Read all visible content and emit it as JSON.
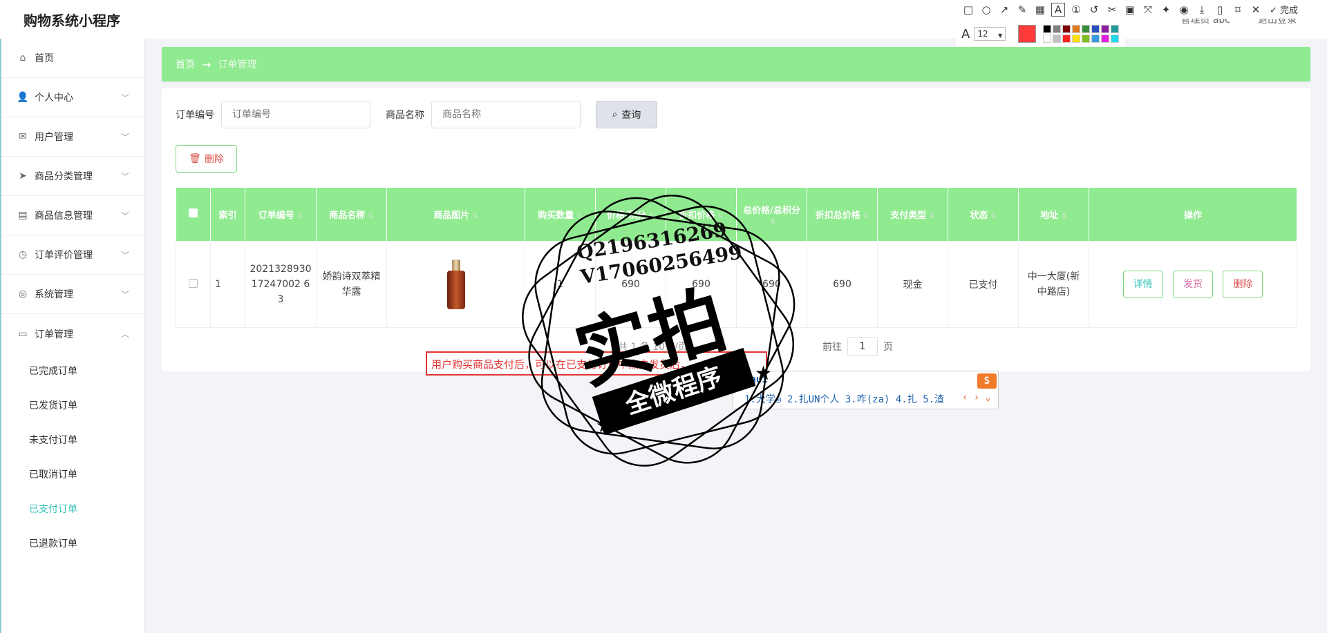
{
  "app": {
    "title": "购物系统小程序",
    "user_label": "管理员 abc",
    "logout_label": "退出登录"
  },
  "sidebar": {
    "items": [
      {
        "label": "首页",
        "icon": "home-icon",
        "expandable": false
      },
      {
        "label": "个人中心",
        "icon": "user-icon",
        "expandable": true
      },
      {
        "label": "用户管理",
        "icon": "mail-icon",
        "expandable": true
      },
      {
        "label": "商品分类管理",
        "icon": "send-icon",
        "expandable": true
      },
      {
        "label": "商品信息管理",
        "icon": "chat-icon",
        "expandable": true
      },
      {
        "label": "订单评价管理",
        "icon": "clock-icon",
        "expandable": true
      },
      {
        "label": "系统管理",
        "icon": "compass-icon",
        "expandable": true
      },
      {
        "label": "订单管理",
        "icon": "message-icon",
        "expandable": true,
        "expanded": true
      }
    ],
    "subitems": [
      {
        "label": "已完成订单"
      },
      {
        "label": "已发货订单"
      },
      {
        "label": "未支付订单"
      },
      {
        "label": "已取消订单"
      },
      {
        "label": "已支付订单",
        "active": true
      },
      {
        "label": "已退款订单"
      }
    ]
  },
  "breadcrumb": {
    "home": "首页",
    "arrow": "→",
    "current": "订单管理"
  },
  "search": {
    "order_no_label": "订单编号",
    "order_no_placeholder": "订单编号",
    "product_name_label": "商品名称",
    "product_name_placeholder": "商品名称",
    "query_label": "查询"
  },
  "toolbar": {
    "delete_label": "删除"
  },
  "table": {
    "headers": [
      "索引",
      "订单编号",
      "商品名称",
      "商品图片",
      "购买数量",
      "价格/积分",
      "折扣价格",
      "总价格/总积分",
      "折扣总价格",
      "支付类型",
      "状态",
      "地址",
      "操作"
    ],
    "rows": [
      {
        "index": "1",
        "order_no": "202132893017247002 63",
        "product_name": "娇韵诗双萃精华露",
        "quantity": "1",
        "price": "690",
        "discount_price": "690",
        "total_price": "690",
        "discount_total": "690",
        "pay_type": "现金",
        "status": "已支付",
        "address": "中一大厦(新中路店)",
        "ops": [
          "详情",
          "发货",
          "删除"
        ]
      }
    ]
  },
  "pager": {
    "partial_text": "共 1 条  10条/页",
    "goto_label": "前往",
    "page_value": "1",
    "page_suffix": "页"
  },
  "snip_tool": {
    "font_size": "12",
    "done_label": "完成",
    "current_color": "#ff3b3b",
    "palette": [
      "#000000",
      "#808080",
      "#800000",
      "#e07b20",
      "#3a8a3a",
      "#2b4fbf",
      "#8a1fa0",
      "#1f9a9a",
      "#ffffff",
      "#c0c0c0",
      "#ff2020",
      "#ffe000",
      "#80c020",
      "#3a9ae0",
      "#e020e0",
      "#20d8e8"
    ]
  },
  "annotation": {
    "text": "用户购买商品支付后，可以在已支付订单中点击发货后，"
  },
  "ime": {
    "composition": "daui",
    "candidates": "1.大学◎  2.扎UN个人  3.咋(za)  4.扎  5.渣",
    "logo": "S"
  },
  "watermark": {
    "line1": "Q2196316269",
    "line2": "V17060256499",
    "big": "实拍",
    "ribbon": "全微程序"
  }
}
